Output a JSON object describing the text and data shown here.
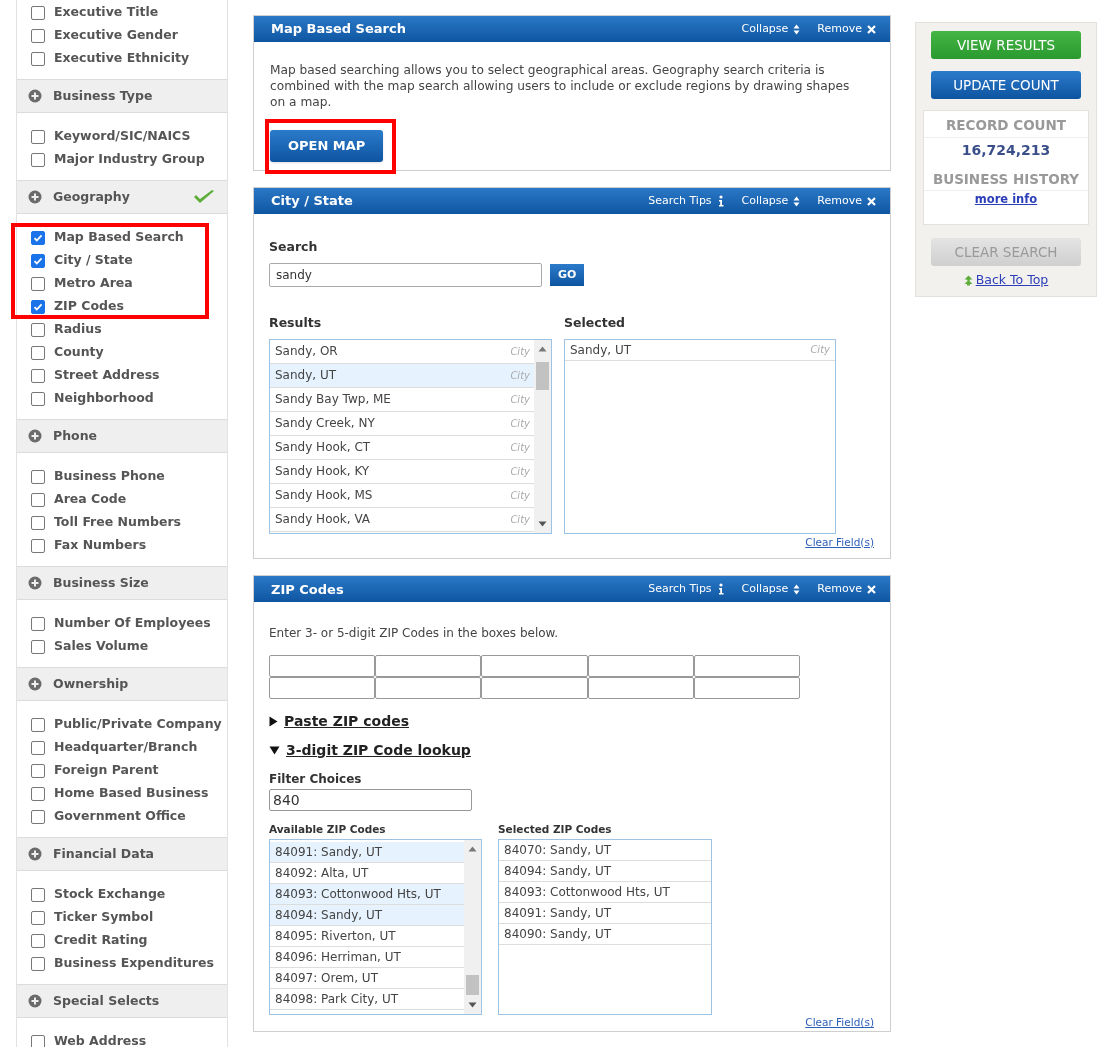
{
  "sidebar": {
    "sections": [
      {
        "items": [
          {
            "label": "Executive Title",
            "checked": false
          },
          {
            "label": "Executive Gender",
            "checked": false
          },
          {
            "label": "Executive Ethnicity",
            "checked": false
          }
        ]
      },
      {
        "title": "Business Type",
        "has_selection": false,
        "annotated": false,
        "items": [
          {
            "label": "Keyword/SIC/NAICS",
            "checked": false
          },
          {
            "label": "Major Industry Group",
            "checked": false
          }
        ]
      },
      {
        "title": "Geography",
        "has_selection": true,
        "annotated": true,
        "items": [
          {
            "label": "Map Based Search",
            "checked": true
          },
          {
            "label": "City / State",
            "checked": true
          },
          {
            "label": "Metro Area",
            "checked": false
          },
          {
            "label": "ZIP Codes",
            "checked": true
          },
          {
            "label": "Radius",
            "checked": false
          },
          {
            "label": "County",
            "checked": false
          },
          {
            "label": "Street Address",
            "checked": false
          },
          {
            "label": "Neighborhood",
            "checked": false
          }
        ]
      },
      {
        "title": "Phone",
        "has_selection": false,
        "annotated": false,
        "items": [
          {
            "label": "Business Phone",
            "checked": false
          },
          {
            "label": "Area Code",
            "checked": false
          },
          {
            "label": "Toll Free Numbers",
            "checked": false
          },
          {
            "label": "Fax Numbers",
            "checked": false
          }
        ]
      },
      {
        "title": "Business Size",
        "has_selection": false,
        "annotated": false,
        "items": [
          {
            "label": "Number Of Employees",
            "checked": false
          },
          {
            "label": "Sales Volume",
            "checked": false
          }
        ]
      },
      {
        "title": "Ownership",
        "has_selection": false,
        "annotated": false,
        "items": [
          {
            "label": "Public/Private Company",
            "checked": false
          },
          {
            "label": "Headquarter/Branch",
            "checked": false
          },
          {
            "label": "Foreign Parent",
            "checked": false
          },
          {
            "label": "Home Based Business",
            "checked": false
          },
          {
            "label": "Government Office",
            "checked": false
          }
        ]
      },
      {
        "title": "Financial Data",
        "has_selection": false,
        "annotated": false,
        "items": [
          {
            "label": "Stock Exchange",
            "checked": false
          },
          {
            "label": "Ticker Symbol",
            "checked": false
          },
          {
            "label": "Credit Rating",
            "checked": false
          },
          {
            "label": "Business Expenditures",
            "checked": false
          }
        ]
      },
      {
        "title": "Special Selects",
        "has_selection": false,
        "annotated": false,
        "items": [
          {
            "label": "Web Address",
            "checked": false
          }
        ]
      }
    ]
  },
  "map_panel": {
    "title": "Map Based Search",
    "actions": [
      {
        "kind": "collapse",
        "label": "Collapse"
      },
      {
        "kind": "remove",
        "label": "Remove"
      }
    ],
    "description": "Map based searching allows you to select geographical areas. Geography search criteria is combined with the map search allowing users to include or exclude regions by drawing shapes on a map.",
    "button": {
      "label": "OPEN MAP",
      "annotated": true
    }
  },
  "city_panel": {
    "title": "City / State",
    "actions": [
      {
        "kind": "tips",
        "label": "Search Tips"
      },
      {
        "kind": "collapse",
        "label": "Collapse"
      },
      {
        "kind": "remove",
        "label": "Remove"
      }
    ],
    "search_label": "Search",
    "search_value": "sandy",
    "go": "GO",
    "results_label": "Results",
    "selected_label": "Selected",
    "results": [
      {
        "name": "Sandy, OR",
        "type": "City",
        "selected": false
      },
      {
        "name": "Sandy, UT",
        "type": "City",
        "selected": true
      },
      {
        "name": "Sandy Bay Twp, ME",
        "type": "City",
        "selected": false
      },
      {
        "name": "Sandy Creek, NY",
        "type": "City",
        "selected": false
      },
      {
        "name": "Sandy Hook, CT",
        "type": "City",
        "selected": false
      },
      {
        "name": "Sandy Hook, KY",
        "type": "City",
        "selected": false
      },
      {
        "name": "Sandy Hook, MS",
        "type": "City",
        "selected": false
      },
      {
        "name": "Sandy Hook, VA",
        "type": "City",
        "selected": false
      }
    ],
    "selected_items": [
      {
        "name": "Sandy, UT",
        "type": "City"
      }
    ],
    "clear_link": "Clear Field(s)"
  },
  "zip_panel": {
    "title": "ZIP Codes",
    "actions": [
      {
        "kind": "tips",
        "label": "Search Tips"
      },
      {
        "kind": "collapse",
        "label": "Collapse"
      },
      {
        "kind": "remove",
        "label": "Remove"
      }
    ],
    "instruction": "Enter 3- or 5-digit ZIP Codes in the boxes below.",
    "toggles": [
      {
        "label": "Paste ZIP codes",
        "expanded": false
      },
      {
        "label": "3-digit ZIP Code lookup",
        "expanded": true
      }
    ],
    "filter_label": "Filter Choices",
    "filter_value": "840",
    "available_label": "Available ZIP Codes",
    "selected_label": "Selected ZIP Codes",
    "available": [
      {
        "label": "84091: Sandy, UT",
        "selected": true
      },
      {
        "label": "84092: Alta, UT",
        "selected": false
      },
      {
        "label": "84093: Cottonwood Hts, UT",
        "selected": true
      },
      {
        "label": "84094: Sandy, UT",
        "selected": true
      },
      {
        "label": "84095: Riverton, UT",
        "selected": false
      },
      {
        "label": "84096: Herriman, UT",
        "selected": false
      },
      {
        "label": "84097: Orem, UT",
        "selected": false
      },
      {
        "label": "84098: Park City, UT",
        "selected": false
      }
    ],
    "selected_items": [
      "84070: Sandy, UT",
      "84094: Sandy, UT",
      "84093: Cottonwood Hts, UT",
      "84091: Sandy, UT",
      "84090: Sandy, UT"
    ],
    "clear_link": "Clear Field(s)"
  },
  "summary": {
    "view_results": "VIEW RESULTS",
    "update_count": "UPDATE COUNT",
    "record_count_label": "RECORD COUNT",
    "record_count": "16,724,213",
    "history_label": "BUSINESS HISTORY",
    "more_info": "more info",
    "clear_search": "CLEAR SEARCH",
    "back_to_top": "Back To Top"
  }
}
